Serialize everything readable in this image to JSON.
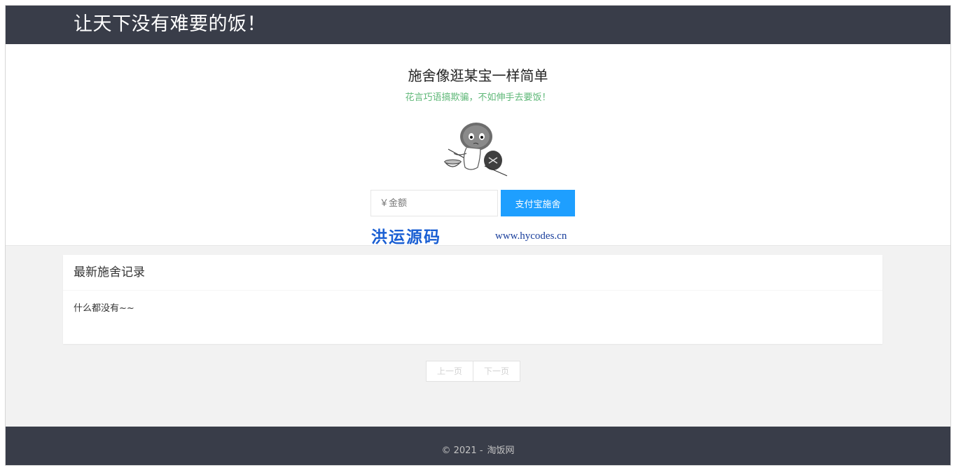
{
  "header": {
    "site_title": "让天下没有难要的饭！"
  },
  "hero": {
    "title": "施舍像逛某宝一样简单",
    "subtitle": "花言巧语搞欺骗，不如伸手去要饭！",
    "mascot_icon": "beggar-mascot-icon",
    "amount_placeholder": "￥金额",
    "pay_button_label": "支付宝施舍",
    "accent_color": "#1e9fff",
    "subtitle_color": "#5fb878"
  },
  "watermark": {
    "name": "洪运源码",
    "url": "www.hycodes.cn"
  },
  "records": {
    "title": "最新施舍记录",
    "empty_text": "什么都没有~~"
  },
  "pagination": {
    "prev_label": "上一页",
    "next_label": "下一页"
  },
  "footer": {
    "copyright": "© 2021 -",
    "site_name": "淘饭网"
  },
  "theme": {
    "header_bg": "#393d49",
    "page_bg": "#f2f2f2"
  }
}
